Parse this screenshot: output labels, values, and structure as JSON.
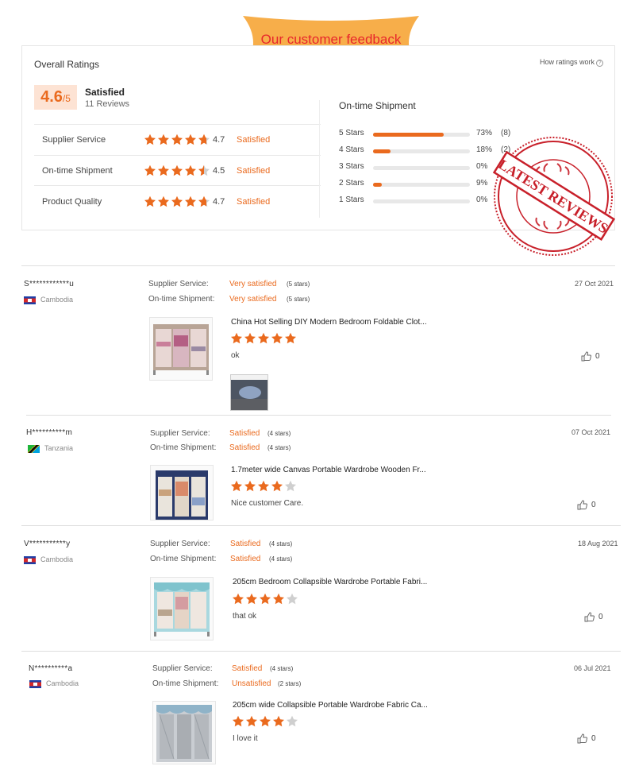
{
  "banner": {
    "text": "Our customer feedback",
    "bg_color": "#f7ae4a",
    "text_color": "#e8262b"
  },
  "overall": {
    "title": "Overall Ratings",
    "how_link": "How ratings work",
    "score": "4.6",
    "score_suffix": "/5",
    "label": "Satisfied",
    "reviews": "11 Reviews",
    "metrics": [
      {
        "label": "Supplier Service",
        "rating": 4.7,
        "value": "4.7",
        "status": "Satisfied"
      },
      {
        "label": "On-time Shipment",
        "rating": 4.5,
        "value": "4.5",
        "status": "Satisfied"
      },
      {
        "label": "Product Quality",
        "rating": 4.7,
        "value": "4.7",
        "status": "Satisfied"
      }
    ]
  },
  "shipment": {
    "title": "On-time Shipment",
    "bars": [
      {
        "label": "5 Stars",
        "fraction": 0.73,
        "pct": "73%",
        "count": "(8)"
      },
      {
        "label": "4 Stars",
        "fraction": 0.18,
        "pct": "18%",
        "count": "(2)"
      },
      {
        "label": "3 Stars",
        "fraction": 0,
        "pct": "0%",
        "count": ""
      },
      {
        "label": "2 Stars",
        "fraction": 0.09,
        "pct": "9%",
        "count": ""
      },
      {
        "label": "1 Stars",
        "fraction": 0,
        "pct": "0%",
        "count": ""
      }
    ]
  },
  "stamp": {
    "text": "LATEST REVIEWS",
    "color": "#c8202a"
  },
  "accent_color": "#ea6a1e",
  "reviews": [
    {
      "name": "S************u",
      "country": "Cambodia",
      "flag": "kh",
      "supplier_label": "Supplier Service:",
      "supplier_value": "Very satisfied",
      "supplier_stars": "(5 stars)",
      "shipment_label": "On-time Shipment:",
      "shipment_value": "Very satisfied",
      "shipment_stars": "(5 stars)",
      "date": "27 Oct 2021",
      "product": "China Hot Selling DIY Modern Bedroom Foldable Clot...",
      "rating": 5,
      "comment": "ok",
      "likes": "0"
    },
    {
      "name": "H**********m",
      "country": "Tanzania",
      "flag": "tz",
      "supplier_label": "Supplier Service:",
      "supplier_value": "Satisfied",
      "supplier_stars": "(4 stars)",
      "shipment_label": "On-time Shipment:",
      "shipment_value": "Satisfied",
      "shipment_stars": "(4 stars)",
      "date": "07 Oct 2021",
      "product": "1.7meter wide Canvas Portable Wardrobe Wooden Fr...",
      "rating": 4,
      "comment": "Nice customer Care.",
      "likes": "0"
    },
    {
      "name": "V***********y",
      "country": "Cambodia",
      "flag": "kh",
      "supplier_label": "Supplier Service:",
      "supplier_value": "Satisfied",
      "supplier_stars": "(4 stars)",
      "shipment_label": "On-time Shipment:",
      "shipment_value": "Satisfied",
      "shipment_stars": "(4 stars)",
      "date": "18 Aug 2021",
      "product": "205cm Bedroom Collapsible Wardrobe Portable Fabri...",
      "rating": 4,
      "comment": "that ok",
      "likes": "0"
    },
    {
      "name": "N**********a",
      "country": "Cambodia",
      "flag": "kh",
      "supplier_label": "Supplier Service:",
      "supplier_value": "Satisfied",
      "supplier_stars": "(4 stars)",
      "shipment_label": "On-time Shipment:",
      "shipment_value": "Unsatisfied",
      "shipment_stars": "(2 stars)",
      "date": "06 Jul 2021",
      "product": "205cm wide Collapsible Portable Wardrobe Fabric Ca...",
      "rating": 4,
      "comment": "I love it",
      "likes": "0"
    }
  ]
}
